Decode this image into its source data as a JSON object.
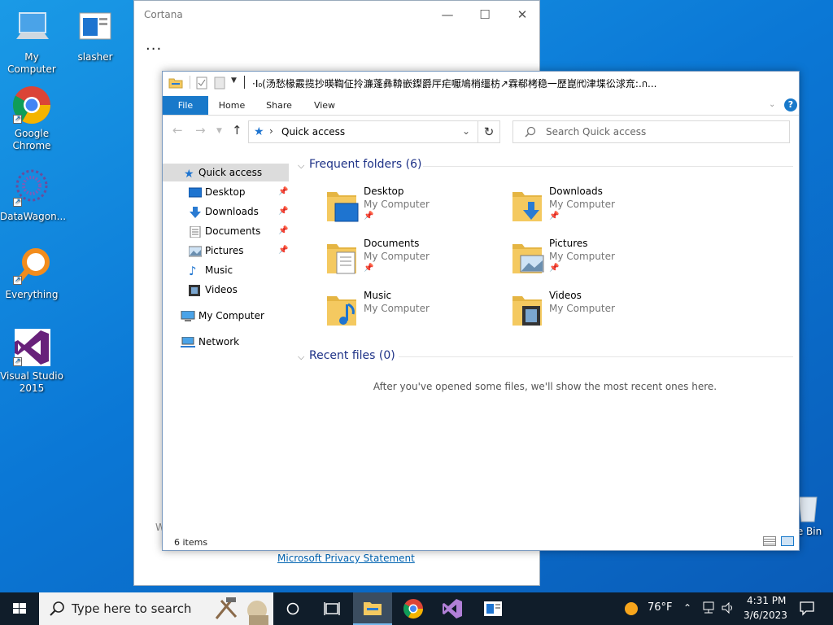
{
  "desktop": {
    "icons": [
      {
        "label": "My Computer",
        "icon": "computer-icon"
      },
      {
        "label": "slasher",
        "icon": "document-icon"
      },
      {
        "label": "Google Chrome",
        "icon": "chrome-icon"
      },
      {
        "label": "DataWagon...",
        "icon": "datawagon-icon"
      },
      {
        "label": "Everything",
        "icon": "everything-search-icon"
      },
      {
        "label": "Visual Studio 2015",
        "icon": "visual-studio-icon"
      },
      {
        "label": "e Bin",
        "icon": "recycle-bin-icon"
      }
    ]
  },
  "cortana": {
    "title": "Cortana",
    "more": "...",
    "partial_text": "W",
    "privacy_link": "Microsoft Privacy Statement"
  },
  "explorer": {
    "title": "·I₀(汤愁椽霰揽抄暎鞫佂拎濂蓬彝鞥嵌鏫爵厈疟嚈鳩梢缰枋↗霖郗栲稳一歴崑㈹津堞彸浗㐬:.ก...",
    "ribbon_tabs": [
      "File",
      "Home",
      "Share",
      "View"
    ],
    "address": "Quick access",
    "search_placeholder": "Search Quick access",
    "nav": {
      "quick_access": "Quick access",
      "items": [
        "Desktop",
        "Downloads",
        "Documents",
        "Pictures",
        "Music",
        "Videos"
      ],
      "my_computer": "My Computer",
      "network": "Network"
    },
    "frequent_header": "Frequent folders (6)",
    "folders": [
      {
        "name": "Desktop",
        "location": "My Computer",
        "pinned": true
      },
      {
        "name": "Downloads",
        "location": "My Computer",
        "pinned": true
      },
      {
        "name": "Documents",
        "location": "My Computer",
        "pinned": true
      },
      {
        "name": "Pictures",
        "location": "My Computer",
        "pinned": true
      },
      {
        "name": "Music",
        "location": "My Computer",
        "pinned": false
      },
      {
        "name": "Videos",
        "location": "My Computer",
        "pinned": false
      }
    ],
    "recent_header": "Recent files (0)",
    "recent_empty": "After you've opened some files, we'll show the most recent ones here.",
    "status": "6 items"
  },
  "taskbar": {
    "search_placeholder": "Type here to search",
    "weather": "76°F",
    "time": "4:31 PM",
    "date": "3/6/2023"
  },
  "colors": {
    "accent": "#1979ca",
    "folder": "#f4c960",
    "taskbar": "#101d2a"
  }
}
